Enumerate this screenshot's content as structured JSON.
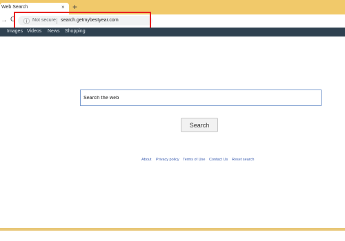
{
  "browser": {
    "tab_title": "Web Search",
    "tab_close_glyph": "×",
    "new_tab_glyph": "+",
    "back_glyph": "→",
    "reload_glyph": "C",
    "info_glyph": "ⓘ",
    "security_label": "Not secure",
    "url": "search.getmybestyear.com"
  },
  "nav": {
    "items": [
      "Images",
      "Videos",
      "News",
      "Shopping"
    ]
  },
  "search": {
    "placeholder": "Search the web",
    "value": "",
    "button_label": "Search"
  },
  "footer": {
    "links": [
      "About",
      "Privacy policy",
      "Terms of Use",
      "Contact Us",
      "Reset search"
    ]
  },
  "colors": {
    "tab_strip": "#f1c96a",
    "highlight_box": "#e82020",
    "nav_strip": "#2f4150",
    "link": "#3b5db0",
    "input_border": "#7f9fd0",
    "bottom_bar": "#e8c778"
  },
  "icons": {
    "back": "arrow-icon",
    "reload": "reload-icon",
    "info": "info-icon",
    "close": "close-icon",
    "new_tab": "plus-icon"
  }
}
